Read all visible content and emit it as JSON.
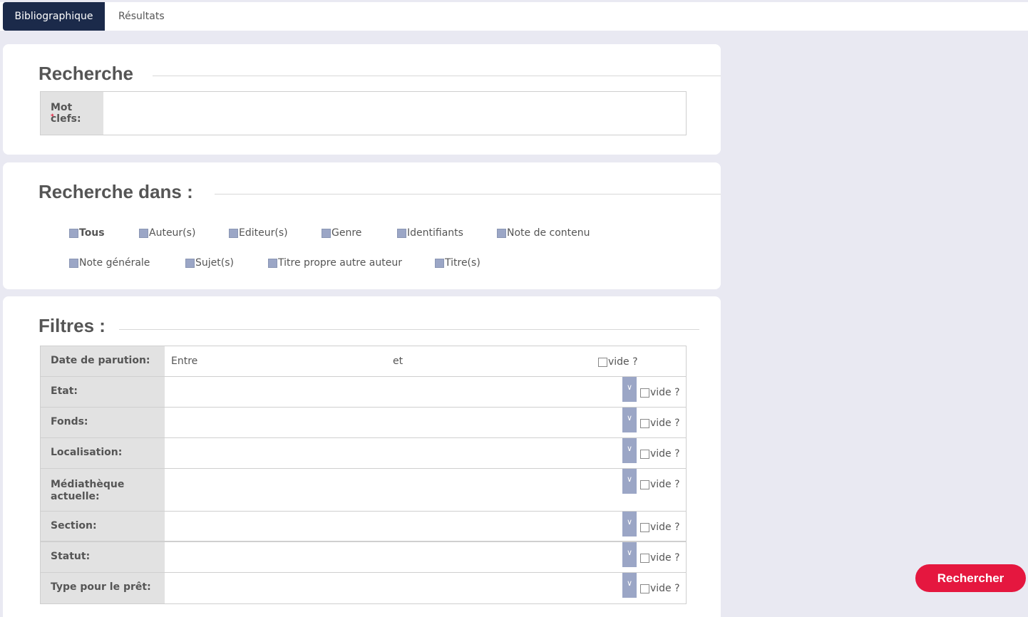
{
  "tabs": [
    {
      "label": "Bibliographique",
      "active": true
    },
    {
      "label": "Résultats",
      "active": false
    }
  ],
  "recherche": {
    "title": "Recherche",
    "keyword_label": "Mot clefs:",
    "required_mark": "*",
    "keyword_value": ""
  },
  "recherche_dans": {
    "title": "Recherche dans :",
    "options": [
      {
        "label": "Tous",
        "bold": true
      },
      {
        "label": "Auteur(s)"
      },
      {
        "label": "Editeur(s)"
      },
      {
        "label": "Genre"
      },
      {
        "label": "Identifiants"
      },
      {
        "label": "Note de contenu"
      },
      {
        "label": "Note générale"
      },
      {
        "label": "Sujet(s)"
      },
      {
        "label": "Titre propre autre auteur"
      },
      {
        "label": "Titre(s)"
      }
    ]
  },
  "filtres": {
    "title": "Filtres :",
    "empty_label": "vide ?",
    "date_between": "Entre",
    "date_and": "et",
    "dropdown_icon": "chevron-down-icon",
    "rows": [
      {
        "label": "Date de parution:"
      },
      {
        "label": "Etat:"
      },
      {
        "label": "Fonds:"
      },
      {
        "label": "Localisation:"
      },
      {
        "label": "Médiathèque actuelle:"
      },
      {
        "label": "Section:"
      },
      {
        "label": "Statut:"
      },
      {
        "label": "Type pour le prêt:"
      }
    ]
  },
  "search_button": {
    "label": "Rechercher"
  },
  "colors": {
    "tab_active": "#1b2a4a",
    "accent": "#e5173f",
    "checkbox": "#9ba6c6",
    "background": "#e9e9f2"
  }
}
